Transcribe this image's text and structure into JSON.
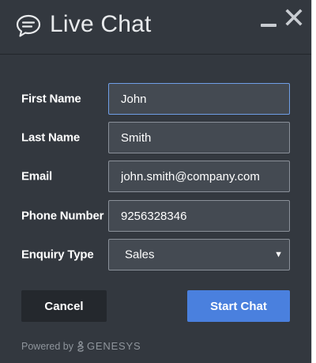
{
  "header": {
    "title": "Live Chat",
    "icon": "chat-bubble-icon"
  },
  "form": {
    "first_name": {
      "label": "First Name",
      "value": "John"
    },
    "last_name": {
      "label": "Last Name",
      "value": "Smith"
    },
    "email": {
      "label": "Email",
      "value": "john.smith@company.com"
    },
    "phone": {
      "label": "Phone Number",
      "value": "9256328346"
    },
    "enquiry_type": {
      "label": "Enquiry Type",
      "selected": "Sales"
    }
  },
  "actions": {
    "cancel_label": "Cancel",
    "start_label": "Start Chat"
  },
  "footer": {
    "powered_by": "Powered by",
    "brand": "GENESYS"
  },
  "colors": {
    "background": "#33383f",
    "field_background": "#444a52",
    "accent": "#4a80de",
    "cancel_background": "#24282d"
  }
}
